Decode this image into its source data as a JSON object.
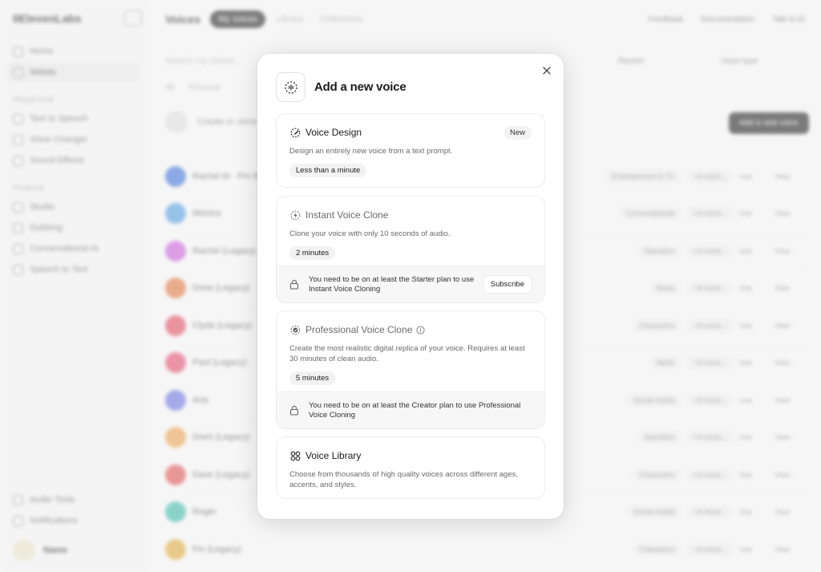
{
  "app": {
    "logo": "IIElevenLabs",
    "nav": {
      "home": "Home",
      "voices": "Voices",
      "section_playground": "Playground",
      "text_to_speech": "Text to Speech",
      "voice_changer": "Voice Changer",
      "sound_effects": "Sound Effects",
      "section_products": "Products",
      "studio": "Studio",
      "dubbing": "Dubbing",
      "conversational_ai": "Conversational AI",
      "speech_to_text": "Speech to Text",
      "audio_tools": "Audio Tools",
      "notifications": "Notifications"
    },
    "user": {
      "name": "Name",
      "email": ""
    },
    "topbar": {
      "title": "Voices",
      "tabs": [
        "My voices",
        "Library",
        "Collections"
      ],
      "feedback": "Feedback",
      "documentation": "Documentation",
      "talk_to": "Talk to El"
    },
    "search_placeholder": "Search my voices...",
    "sort_label": "Recent",
    "voice_type_label": "Voice type",
    "category_tabs": [
      "All",
      "Personal"
    ],
    "create_label": "Create or clone",
    "add_voice_button": "Add a new voice",
    "voices": [
      {
        "name": "Rachel M - Pro B",
        "tag": "Entertainment & TV",
        "color": "#3b6fd8"
      },
      {
        "name": "Monica",
        "tag": "Conversational",
        "color": "#4d9be0"
      },
      {
        "name": "Rachel (Legacy)",
        "tag": "Narration",
        "color": "#c85ad8"
      },
      {
        "name": "Drew (Legacy)",
        "tag": "News",
        "color": "#e0733a"
      },
      {
        "name": "Clyde (Legacy)",
        "tag": "Characters",
        "color": "#e04a5a"
      },
      {
        "name": "Paul (Legacy)",
        "tag": "News",
        "color": "#e24b6b"
      },
      {
        "name": "Aria",
        "tag": "Social media",
        "color": "#6b6fe0"
      },
      {
        "name": "Domi (Legacy)",
        "tag": "Narration",
        "color": "#e8a04a"
      },
      {
        "name": "Dave (Legacy)",
        "tag": "Characters",
        "color": "#e0504f"
      },
      {
        "name": "Roger",
        "tag": "Social media",
        "color": "#3bb8a8"
      },
      {
        "name": "Fin (Legacy)",
        "tag": "Characters",
        "color": "#e0a83a"
      }
    ],
    "row_actions": {
      "more": "+4 more...",
      "use": "Use",
      "view": "View"
    }
  },
  "modal": {
    "title": "Add a new voice",
    "cards": {
      "voice_design": {
        "title": "Voice Design",
        "badge": "New",
        "description": "Design an entirely new voice from a text prompt.",
        "time": "Less than a minute"
      },
      "instant_clone": {
        "title": "Instant Voice Clone",
        "description": "Clone your voice with only 10 seconds of audio.",
        "time": "2 minutes",
        "lock_message": "You need to be on at least the Starter plan to use Instant Voice Cloning",
        "subscribe": "Subscribe"
      },
      "professional_clone": {
        "title": "Professional Voice Clone",
        "description": "Create the most realistic digital replica of your voice. Requires at least 30 minutes of clean audio.",
        "time": "5 minutes",
        "lock_message": "You need to be on at least the Creator plan to use Professional Voice Cloning"
      },
      "voice_library": {
        "title": "Voice Library",
        "description": "Choose from thousands of high quality voices across different ages, accents, and styles."
      }
    }
  }
}
